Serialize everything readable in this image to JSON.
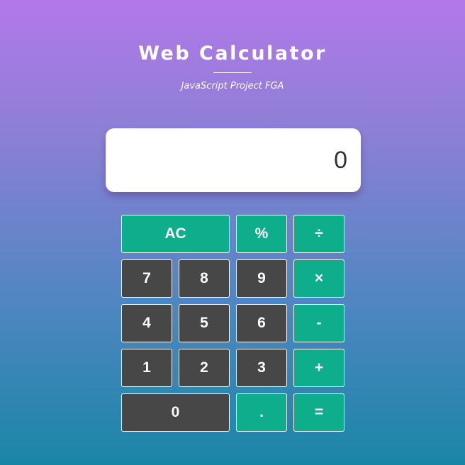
{
  "header": {
    "title": "Web Calculator",
    "subtitle": "JavaScript Project FGA"
  },
  "display": {
    "value": "0"
  },
  "keys": {
    "ac": "AC",
    "percent": "%",
    "divide": "÷",
    "seven": "7",
    "eight": "8",
    "nine": "9",
    "multiply": "×",
    "four": "4",
    "five": "5",
    "six": "6",
    "subtract": "-",
    "one": "1",
    "two": "2",
    "three": "3",
    "add": "+",
    "zero": "0",
    "decimal": ".",
    "equals": "="
  },
  "colors": {
    "operator_key": "#0ead8b",
    "number_key": "#474747",
    "background_top": "#b378ea",
    "background_bottom": "#1a86a6"
  }
}
